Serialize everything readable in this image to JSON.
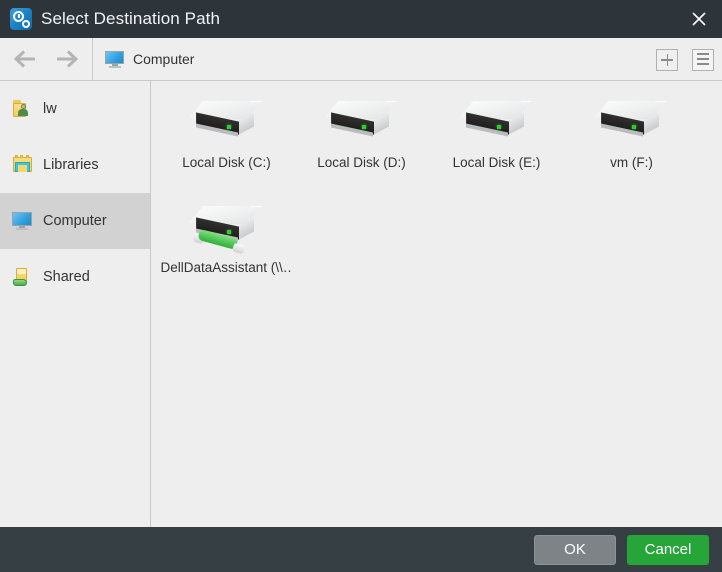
{
  "window": {
    "title": "Select Destination Path",
    "title_icon": "app-clock-gear-icon",
    "close_icon": "close-icon"
  },
  "toolbar": {
    "back_icon": "arrow-left-icon",
    "forward_icon": "arrow-right-icon",
    "location_icon": "computer-monitor-icon",
    "location": "Computer",
    "new_folder_icon": "plus-icon",
    "view_mode_icon": "list-view-icon"
  },
  "sidebar": {
    "items": [
      {
        "label": "lw",
        "icon": "user-folder-icon",
        "selected": false
      },
      {
        "label": "Libraries",
        "icon": "libraries-icon",
        "selected": false
      },
      {
        "label": "Computer",
        "icon": "computer-monitor-icon",
        "selected": true
      },
      {
        "label": "Shared",
        "icon": "shared-folder-icon",
        "selected": false
      }
    ]
  },
  "content": {
    "items": [
      {
        "label": "Local Disk (C:)",
        "icon": "hard-drive-icon",
        "type": "local"
      },
      {
        "label": "Local Disk (D:)",
        "icon": "hard-drive-icon",
        "type": "local"
      },
      {
        "label": "Local Disk (E:)",
        "icon": "hard-drive-icon",
        "type": "local"
      },
      {
        "label": "vm (F:)",
        "icon": "hard-drive-icon",
        "type": "local"
      },
      {
        "label": "DellDataAssistant (\\\\…",
        "icon": "network-drive-icon",
        "type": "network"
      }
    ]
  },
  "footer": {
    "ok_label": "OK",
    "cancel_label": "Cancel"
  },
  "colors": {
    "titlebar": "#2e353a",
    "footer": "#363f44",
    "accent_green": "#26a539",
    "ok_gray": "#7d8387",
    "selection": "#d2d2d2",
    "surface": "#eeeeee"
  }
}
